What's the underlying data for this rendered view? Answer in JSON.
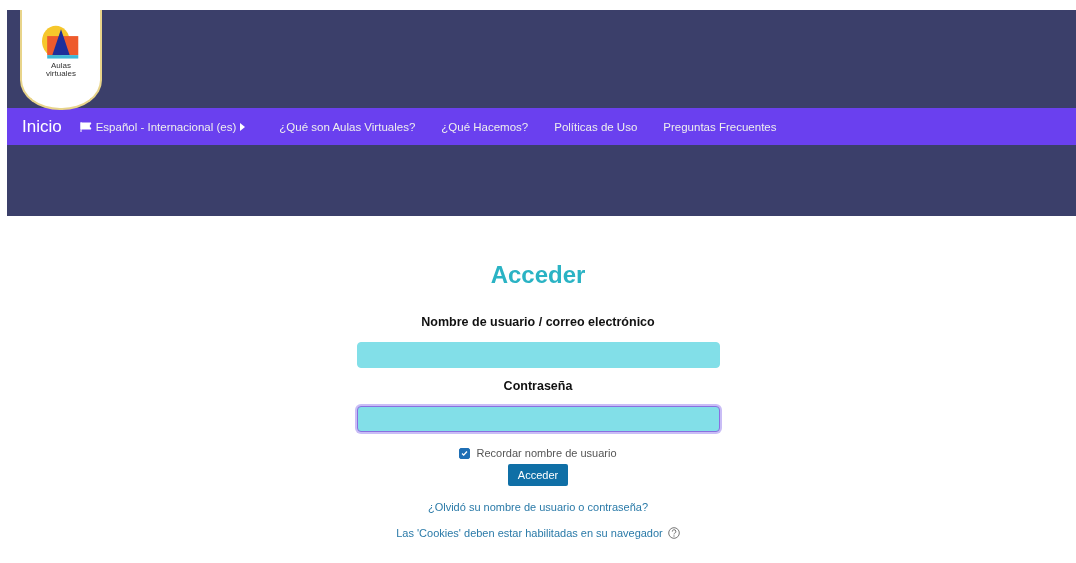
{
  "header": {
    "logo_text": [
      "Aulas",
      "virtuales"
    ]
  },
  "nav": {
    "home": "Inicio",
    "language": "Español - Internacional (es)",
    "links": [
      "¿Qué son Aulas Virtuales?",
      "¿Qué Hacemos?",
      "Políticas de Uso",
      "Preguntas Frecuentes"
    ]
  },
  "login": {
    "title": "Acceder",
    "fields": [
      {
        "label": "Nombre de usuario / correo electrónico",
        "focused": false
      },
      {
        "label": "Contraseña",
        "focused": true
      }
    ],
    "remember": {
      "label": "Recordar nombre de usuario",
      "checked": true
    },
    "submit": "Acceder",
    "forgot": "¿Olvidó su nombre de usuario o contraseña?",
    "cookies": "Las 'Cookies' deben estar habilitadas en su navegador"
  }
}
